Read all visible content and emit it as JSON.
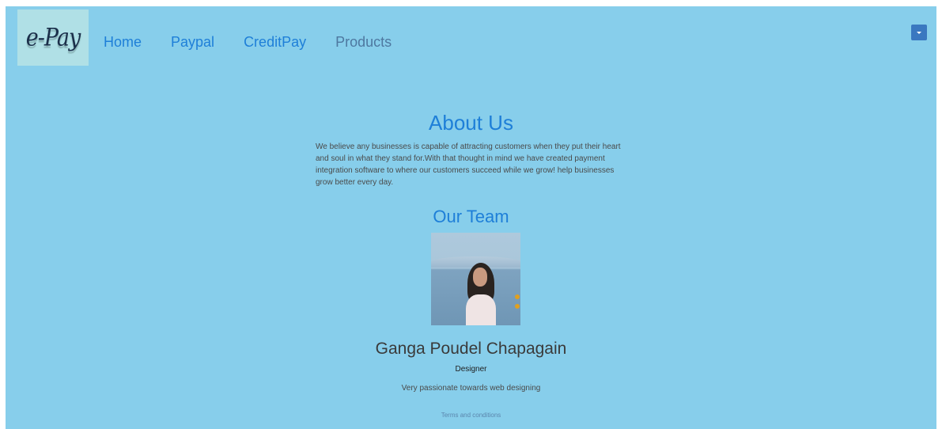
{
  "brand": {
    "logo_text": "e-Pay"
  },
  "nav": {
    "items": [
      {
        "label": "Home"
      },
      {
        "label": "Paypal"
      },
      {
        "label": "CreditPay"
      },
      {
        "label": "Products"
      }
    ],
    "menu_toggle_icon": "caret-down-icon"
  },
  "about": {
    "title": "About Us",
    "text": "We believe any businesses is capable of attracting customers when they put their heart and soul in what they stand for.With that thought in mind we have created payment integration software to where our customers succeed while we grow! help businesses grow better every day."
  },
  "team": {
    "title": "Our Team",
    "members": [
      {
        "name": "Ganga Poudel Chapagain",
        "role": "Designer",
        "description": "Very passionate towards web designing"
      }
    ]
  },
  "footer": {
    "terms_label": "Terms and conditions"
  },
  "colors": {
    "page_background": "#87ceeb",
    "logo_background": "#b0e0e6",
    "link": "#1e7fd8",
    "toggle": "#3a78c0"
  }
}
